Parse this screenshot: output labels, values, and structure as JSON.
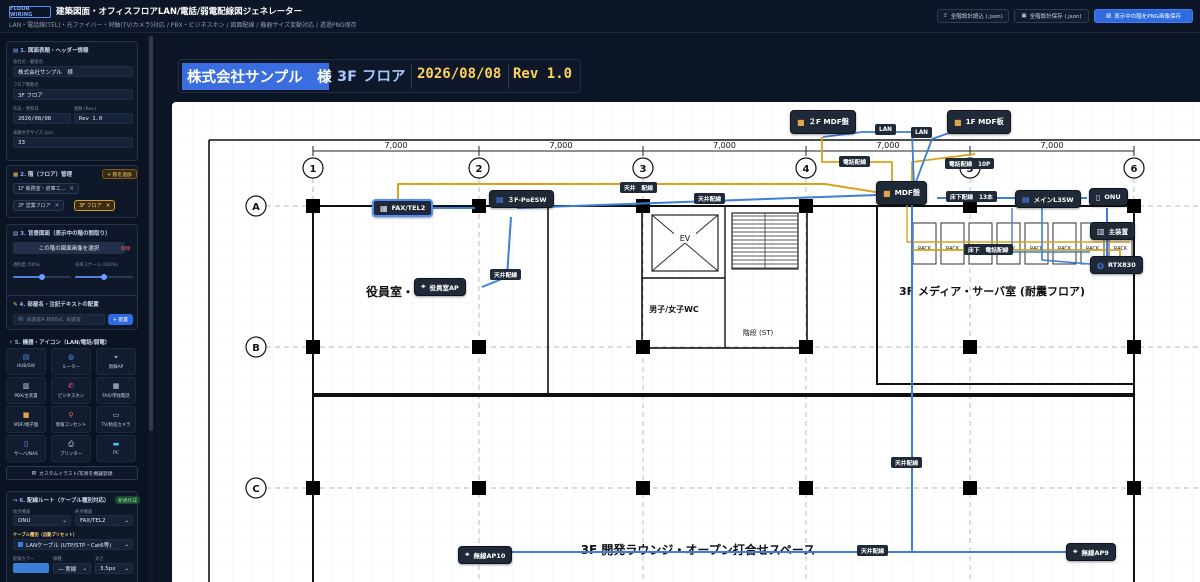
{
  "header": {
    "logo": "FLOOR WIRING",
    "title": "建築図面・オフィスフロアLAN/電話/弱電配線図ジェネレーター",
    "subtitle": "LAN・電話線(TEL)・光ファイバー・同軸(TV/カメラ)対応 / PBX・ビジネスホン / 図面配線 / 機器サイズ変動対応 / 透過PNG保存",
    "btn_load": "全階設計読込 (.json)",
    "btn_save": "全階設計保存 (.json)",
    "btn_png": "表示中の階をPNG画像保存"
  },
  "sidebar": {
    "s1": {
      "num": "1.",
      "title": "図面表題・ヘッダー情報",
      "company_label": "会社名・顧客名",
      "company_value": "株式会社サンプル　様",
      "floor_label": "フロア階数名",
      "floor_value": "3F フロア",
      "date_label": "作成・更新日",
      "date_value": "2026/08/08",
      "rev_label": "版数 (Rev.)",
      "rev_value": "Rev 1.0",
      "size_label": "表題文字サイズ (px)",
      "size_value": "33"
    },
    "s2": {
      "num": "2.",
      "title": "階（フロア）管理",
      "add": "+ 階を追加",
      "floors": [
        "1F 執務室・倉庫エ...",
        "2F 営業フロア",
        "3F フロア"
      ]
    },
    "s3": {
      "num": "3.",
      "title": "背景図面（表示中の階の間取り）",
      "select": "この階の図面画像を選択",
      "delete": "削除",
      "opacity_label": "透明度 (50%)",
      "opacity": 0.5,
      "scale_label": "倍率スケール (100%)",
      "scale": 0.5
    },
    "s4": {
      "num": "4.",
      "title": "部屋名・注記テキストの配置",
      "placeholder": "例: 会議室A 約80㎡, 会議室",
      "place": "+ 配置"
    },
    "s5": {
      "num": "5.",
      "title": "機器・アイコン（LAN/電話/弱電）",
      "devices": [
        {
          "label": "HUB/SW",
          "icon": "switch-icon",
          "glyph": "▤",
          "color": "#4f8cff"
        },
        {
          "label": "ルーター",
          "icon": "globe-icon",
          "glyph": "◍",
          "color": "#4f8cff"
        },
        {
          "label": "無線AP",
          "icon": "antenna-icon",
          "glyph": "⌖",
          "color": "#cfd9e8"
        },
        {
          "label": "PBX/主装置",
          "icon": "building-icon",
          "glyph": "▥",
          "color": "#cfd9e8"
        },
        {
          "label": "ビジネスホン",
          "icon": "phone-icon",
          "glyph": "✆",
          "color": "#ff5b8a"
        },
        {
          "label": "FAX/単独電話",
          "icon": "fax-icon",
          "glyph": "▦",
          "color": "#cfd9e8"
        },
        {
          "label": "MDF/端子盤",
          "icon": "box-icon",
          "glyph": "■",
          "color": "#e3a34a"
        },
        {
          "label": "情報コンセント",
          "icon": "pin-icon",
          "glyph": "⚲",
          "color": "#ff5b5b"
        },
        {
          "label": "TV/防犯カメラ",
          "icon": "tv-icon",
          "glyph": "▭",
          "color": "#9bd0ff"
        },
        {
          "label": "サーバ/NAS",
          "icon": "server-icon",
          "glyph": "▯",
          "color": "#9aa6ff"
        },
        {
          "label": "プリンター",
          "icon": "printer-icon",
          "glyph": "⎙",
          "color": "#cfd9e8"
        },
        {
          "label": "PC",
          "icon": "pc-icon",
          "glyph": "▬",
          "color": "#4fc3ff"
        }
      ],
      "custom": "カスタムイラスト/写真を機器登録"
    },
    "s6": {
      "num": "6.",
      "title": "配線ルート（ケーブル種別対応）",
      "badge": "新規作成",
      "start_label": "始点機器",
      "start_value": "ONU",
      "end_label": "終点機器",
      "end_value": "FAX/TEL2",
      "cable_label": "ケーブル種別（自動プリセット）",
      "cable_value": "LANケーブル (UTP/STP・Cat6等)",
      "color_label": "配線カラー",
      "type_label": "線種",
      "type_value": "― 実線",
      "width_label": "太さ",
      "width_value": "3.5px"
    }
  },
  "title_block": {
    "company": "株式会社サンプル　様",
    "floor": "3F フロア",
    "date": "2026/08/08",
    "rev": "Rev 1.0"
  },
  "plan": {
    "dims": [
      "7,000",
      "7,000",
      "7,000",
      "7,000",
      "7,000"
    ],
    "cols": [
      "1",
      "2",
      "3",
      "4",
      "5",
      "6"
    ],
    "rows": [
      "A",
      "B",
      "C"
    ],
    "rooms": {
      "exec": "役員室・",
      "wc": "男子/女子WC",
      "ev": "EV",
      "stairs": "階段 (ST)",
      "server": "3F メディア・サーバ室 (耐震フロア)",
      "lounge": "3F 開発ラウンジ・オープン打合せスペース",
      "rack": "RACK"
    },
    "nodes": {
      "mdf2": "２F MDF盤",
      "mdf1": "1F MDF板",
      "fax": "FAX/TEL2",
      "poesw": "３F-PoESW",
      "mdf": "MDF盤",
      "l3sw": "メインL3SW",
      "onu": "ONU",
      "pbx": "主装置",
      "rtx": "RTX830",
      "ap_exec": "役員室AP",
      "ap10": "無線AP10",
      "ap9": "無線AP9"
    },
    "labels": {
      "lan1": "LAN",
      "lan2": "LAN",
      "tel_wire": "電話配線",
      "tel_10p": "電話配線　10P",
      "ceiling_a": "天井　配線",
      "ceiling_b": "天井配線",
      "floor13": "床下配線　13本",
      "floor_tel": "床下　電話配線",
      "ceiling_exec": "天井配線",
      "ceiling_mid": "天井配線",
      "ceiling_lounge": "天井配線"
    },
    "colors": {
      "lan": "#3b7fd9",
      "tel": "#d8a21c",
      "wall": "#111111"
    }
  }
}
